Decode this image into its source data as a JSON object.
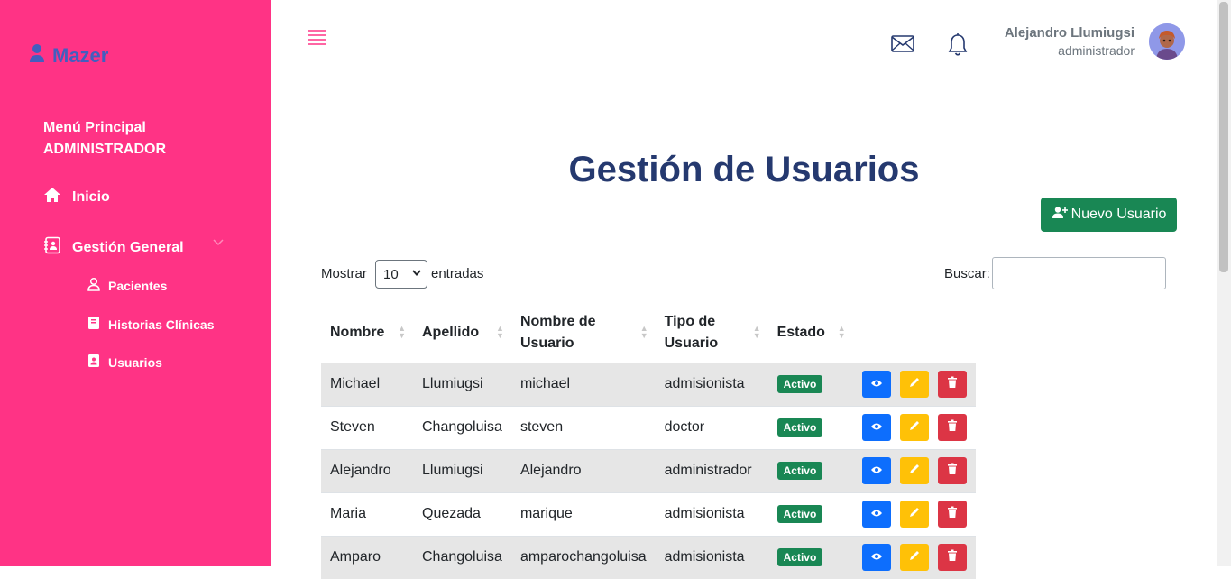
{
  "sidebar": {
    "brand": "Mazer",
    "menu_title_line1": "Menú Principal",
    "menu_title_line2": "ADMINISTRADOR",
    "items": [
      {
        "label": "Inicio"
      },
      {
        "label": "Gestión General"
      }
    ],
    "subitems": [
      {
        "label": "Pacientes"
      },
      {
        "label": "Historias Clínicas"
      },
      {
        "label": "Usuarios"
      }
    ]
  },
  "header": {
    "user_name": "Alejandro Llumiugsi",
    "user_role": "administrador"
  },
  "main": {
    "title": "Gestión de Usuarios",
    "new_button": "Nuevo Usuario",
    "show_label": "Mostrar",
    "show_value": "10",
    "entries_label": "entradas",
    "search_label": "Buscar:",
    "search_value": ""
  },
  "table": {
    "headers": [
      "Nombre",
      "Apellido",
      "Nombre de Usuario",
      "Tipo de Usuario",
      "Estado"
    ],
    "rows": [
      {
        "nombre": "Michael",
        "apellido": "Llumiugsi",
        "usuario": "michael",
        "tipo": "admisionista",
        "estado": "Activo"
      },
      {
        "nombre": "Steven",
        "apellido": "Changoluisa",
        "usuario": "steven",
        "tipo": "doctor",
        "estado": "Activo"
      },
      {
        "nombre": "Alejandro",
        "apellido": "Llumiugsi",
        "usuario": "Alejandro",
        "tipo": "administrador",
        "estado": "Activo"
      },
      {
        "nombre": "Maria",
        "apellido": "Quezada",
        "usuario": "marique",
        "tipo": "admisionista",
        "estado": "Activo"
      },
      {
        "nombre": "Amparo",
        "apellido": "Changoluisa",
        "usuario": "amparochangoluisa",
        "tipo": "admisionista",
        "estado": "Activo"
      }
    ]
  },
  "colors": {
    "sidebar_bg": "#ff3385",
    "brand": "#435ebe",
    "title": "#25396f",
    "success": "#198754",
    "primary": "#0d6efd",
    "warning": "#ffc107",
    "danger": "#dc3545"
  },
  "icons": {
    "brand": "user-icon",
    "inicio": "house-icon",
    "gestion": "contact-book-icon",
    "pacientes": "person-icon",
    "historias": "clipboard-icon",
    "usuarios": "id-badge-icon",
    "menu": "hamburger-icon",
    "mail": "envelope-icon",
    "notifications": "bell-icon",
    "new_user": "person-plus-icon",
    "view": "eye-icon",
    "edit": "pencil-icon",
    "delete": "trash-icon"
  }
}
